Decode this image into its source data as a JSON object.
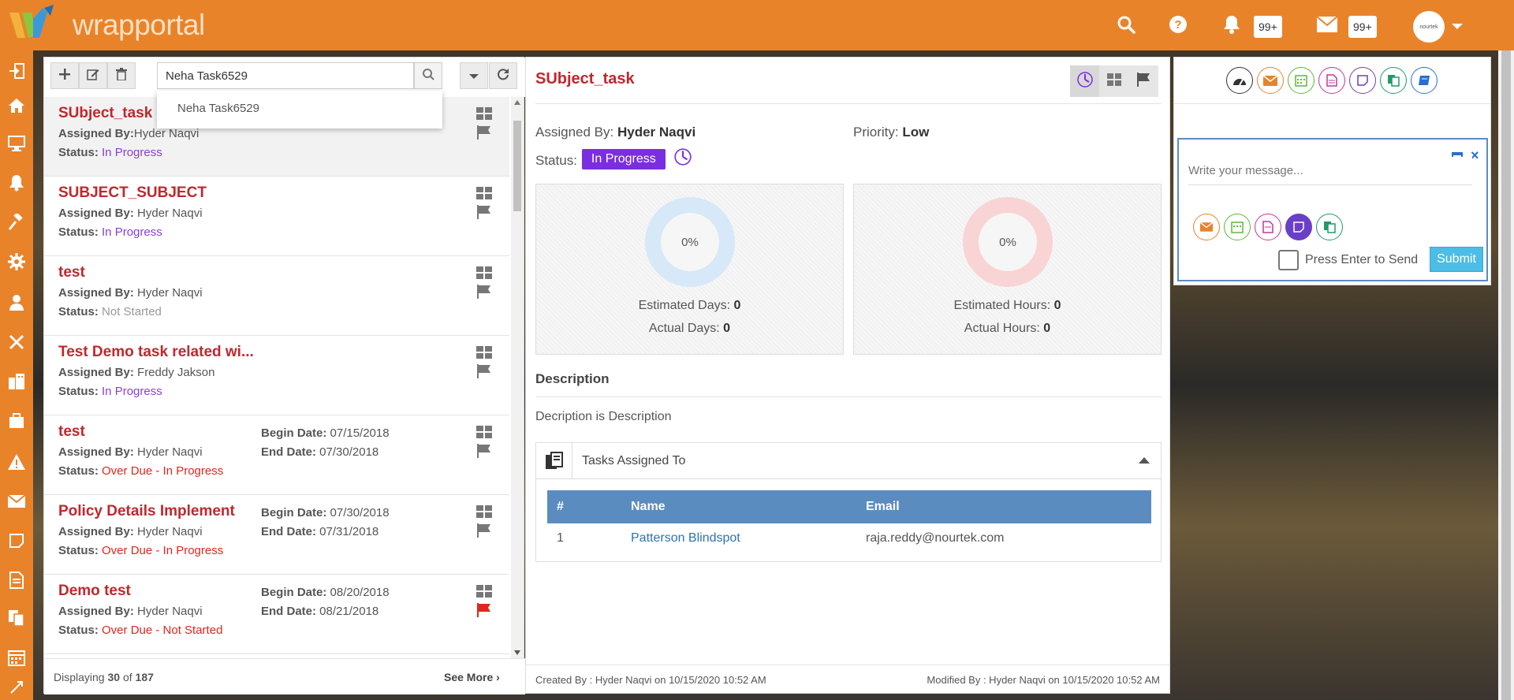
{
  "header": {
    "logo_text": "wrapportal",
    "notifications_badge": "99+",
    "messages_badge": "99+",
    "avatar_text": "nourtek"
  },
  "toolbar": {
    "search_value": "Neha Task6529",
    "dropdown_suggestion": "Neha Task6529"
  },
  "tasks": [
    {
      "title": "SUbject_task",
      "assigned_label": "Assigned By:",
      "assigned_by": "Hyder Naqvi",
      "status_label": "Status:",
      "status": "In Progress",
      "status_kind": "progress"
    },
    {
      "title": "SUBJECT_SUBJECT",
      "assigned_label": "Assigned By:",
      "assigned_by": " Hyder Naqvi",
      "status_label": "Status:",
      "status": "In Progress",
      "status_kind": "progress"
    },
    {
      "title": "test",
      "assigned_label": "Assigned By:",
      "assigned_by": " Hyder Naqvi",
      "status_label": "Status:",
      "status": "Not Started",
      "status_kind": "ns"
    },
    {
      "title": "Test Demo task related wi...",
      "assigned_label": "Assigned By:",
      "assigned_by": " Freddy Jakson",
      "status_label": "Status:",
      "status": "In Progress",
      "status_kind": "progress"
    },
    {
      "title": "test",
      "assigned_label": "Assigned By:",
      "assigned_by": " Hyder Naqvi",
      "status_label": "Status:",
      "status": "Over Due - In Progress",
      "status_kind": "od",
      "begin_label": "Begin Date:",
      "begin": " 07/15/2018",
      "end_label": "End Date:",
      "end": " 07/30/2018"
    },
    {
      "title": "Policy Details Implement",
      "assigned_label": "Assigned By:",
      "assigned_by": " Hyder Naqvi",
      "status_label": "Status:",
      "status": "Over Due - In Progress",
      "status_kind": "od",
      "begin_label": "Begin Date:",
      "begin": " 07/30/2018",
      "end_label": "End Date:",
      "end": " 07/31/2018"
    },
    {
      "title": "Demo test",
      "assigned_label": "Assigned By:",
      "assigned_by": " Hyder Naqvi",
      "status_label": "Status:",
      "status": "Over Due - Not Started",
      "status_kind": "od",
      "begin_label": "Begin Date:",
      "begin": " 08/20/2018",
      "end_label": "End Date:",
      "end": " 08/21/2018",
      "flag_red": true
    }
  ],
  "list_footer": {
    "displaying_label": "Displaying",
    "shown": "30",
    "of_label": "of",
    "total": "187",
    "see_more": "See More"
  },
  "detail": {
    "title": "SUbject_task",
    "assigned_label": "Assigned By:",
    "assigned_by": "Hyder Naqvi",
    "priority_label": "Priority:",
    "priority": "Low",
    "status_label": "Status:",
    "status": "In Progress",
    "days_card": {
      "percent_text": "0%",
      "percent_value": 0,
      "estimated_label": "Estimated Days:",
      "estimated": "0",
      "actual_label": "Actual Days:",
      "actual": "0"
    },
    "hours_card": {
      "percent_text": "0%",
      "percent_value": 0,
      "estimated_label": "Estimated Hours:",
      "estimated": "0",
      "actual_label": "Actual Hours:",
      "actual": "0"
    },
    "description_heading": "Description",
    "description": "Decription is Description",
    "assigned_section_title": "Tasks Assigned To",
    "table_headers": [
      "#",
      "Name",
      "Email"
    ],
    "table_rows": [
      {
        "num": "1",
        "name": "Patterson Blindspot",
        "email": "raja.reddy@nourtek.com"
      }
    ],
    "created": "Created By : Hyder Naqvi on 10/15/2020 10:52 AM",
    "modified": "Modified By : Hyder Naqvi on 10/15/2020 10:52 AM"
  },
  "chat": {
    "placeholder": "Write your message...",
    "enter_label": "Press Enter to Send",
    "submit": "Submit"
  },
  "colors": {
    "brand_orange": "#e9832a",
    "title_red": "#c1272d",
    "status_purple": "#7a2ee0",
    "table_blue": "#5b8cc0",
    "submit_blue": "#4bbde6"
  }
}
